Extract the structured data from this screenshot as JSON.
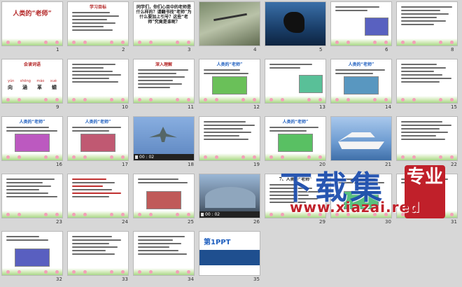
{
  "slides": [
    {
      "number": "1",
      "title": "人类的“老师”",
      "style": "title"
    },
    {
      "number": "2",
      "title": "学习目标",
      "style": "text"
    },
    {
      "number": "3",
      "title": "同学们，你们心目中的老师是什么样的？请翻书找“老师”为什么要加上引号？这些“老师”究竟是谁呢？",
      "style": "question"
    },
    {
      "number": "4",
      "style": "photo-dragonfly"
    },
    {
      "number": "5",
      "style": "photo-orca"
    },
    {
      "number": "6",
      "style": "text-image"
    },
    {
      "number": "8",
      "style": "text"
    },
    {
      "number": "9",
      "title": "会读词语",
      "pinyin": [
        "yún",
        "shēng",
        "máo",
        "xuè"
      ],
      "hanzi": [
        "向",
        "涵",
        "革",
        "蜻"
      ],
      "style": "words"
    },
    {
      "number": "10",
      "style": "text"
    },
    {
      "number": "11",
      "title": "深入理解",
      "style": "text"
    },
    {
      "number": "12",
      "title": "人类的“老师”",
      "style": "image"
    },
    {
      "number": "13",
      "style": "text-image"
    },
    {
      "number": "14",
      "title": "人类的“老师”",
      "style": "image"
    },
    {
      "number": "15",
      "style": "text"
    },
    {
      "number": "16",
      "title": "人类的“老师”",
      "style": "image"
    },
    {
      "number": "17",
      "title": "人类的“老师”",
      "style": "image"
    },
    {
      "number": "18",
      "time": "00 : 02",
      "style": "photo-jet"
    },
    {
      "number": "19",
      "style": "text"
    },
    {
      "number": "20",
      "title": "人类的“老师”",
      "style": "image"
    },
    {
      "number": "21",
      "style": "photo-ship"
    },
    {
      "number": "22",
      "style": "text"
    },
    {
      "number": "23",
      "style": "text"
    },
    {
      "number": "24",
      "style": "text-red"
    },
    {
      "number": "25",
      "style": "image"
    },
    {
      "number": "26",
      "time": "00 : 02",
      "style": "photo-stadium"
    },
    {
      "number": "29",
      "title": "7、人类的“老师”",
      "style": "list"
    },
    {
      "number": "30",
      "style": "image"
    },
    {
      "number": "31",
      "style": "image"
    },
    {
      "number": "32",
      "style": "image"
    },
    {
      "number": "33",
      "style": "text"
    },
    {
      "number": "34",
      "style": "text"
    },
    {
      "number": "35",
      "brand": "第1PPT",
      "style": "brand"
    }
  ],
  "watermark": {
    "main": "下载集",
    "badge": "专业",
    "url": "www.xiazai.red"
  },
  "colors": {
    "accent": "#b22222",
    "blue": "#1f5fbf",
    "slide_bg": "#ffffff",
    "desktop_bg": "#d7d7d7"
  }
}
